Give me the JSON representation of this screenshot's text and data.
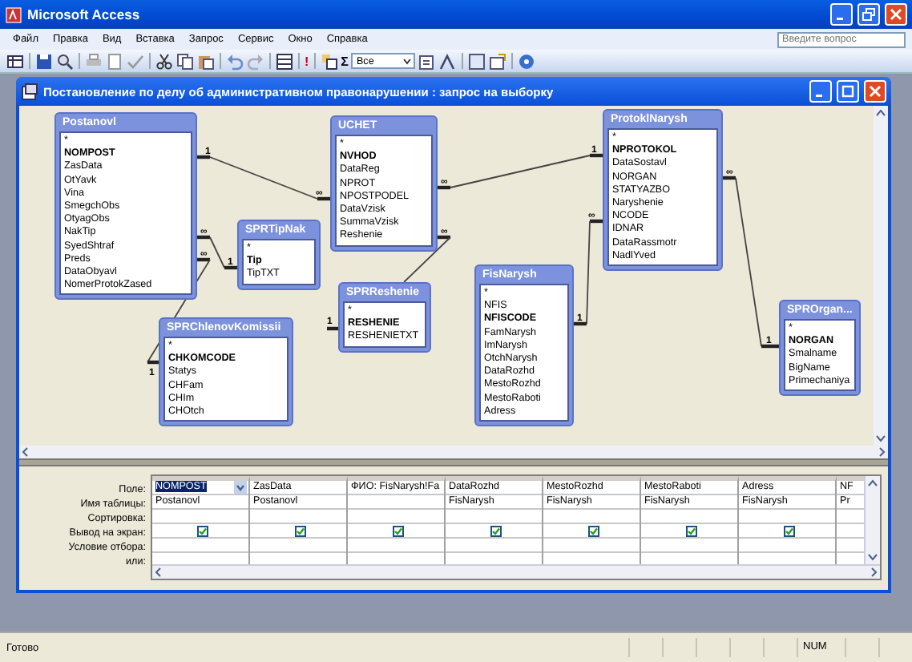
{
  "app": {
    "title": "Microsoft Access",
    "help_placeholder": "Введите вопрос"
  },
  "menu": [
    "Файл",
    "Правка",
    "Вид",
    "Вставка",
    "Запрос",
    "Сервис",
    "Окно",
    "Справка"
  ],
  "toolbar": {
    "run_symbol": "!",
    "totals_symbol": "Σ",
    "top_values": "Все"
  },
  "query_window": {
    "title": "Постановление по делу об административном правонарушении : запрос на выборку"
  },
  "tables": [
    {
      "title": "Postanovl",
      "fields": [
        {
          "name": "*",
          "key": false
        },
        {
          "name": "NOMPOST",
          "key": true
        },
        {
          "name": "ZasData",
          "key": false
        },
        {
          "name": "OtYavk",
          "key": false
        },
        {
          "name": "Vina",
          "key": false
        },
        {
          "name": "SmegchObs",
          "key": false
        },
        {
          "name": "OtyagObs",
          "key": false
        },
        {
          "name": "NakTip",
          "key": false
        },
        {
          "name": "SyedShtraf",
          "key": false
        },
        {
          "name": "Preds",
          "key": false
        },
        {
          "name": "DataObyavl",
          "key": false
        },
        {
          "name": "NomerProtokZased",
          "key": false
        }
      ]
    },
    {
      "title": "UCHET",
      "fields": [
        {
          "name": "*",
          "key": false
        },
        {
          "name": "NVHOD",
          "key": true
        },
        {
          "name": "DataReg",
          "key": false
        },
        {
          "name": "NPROT",
          "key": false
        },
        {
          "name": "NPOSTPODEL",
          "key": false
        },
        {
          "name": "DataVzisk",
          "key": false
        },
        {
          "name": "SummaVzisk",
          "key": false
        },
        {
          "name": "Reshenie",
          "key": false
        }
      ]
    },
    {
      "title": "SPRTipNak",
      "fields": [
        {
          "name": "*",
          "key": false
        },
        {
          "name": "Tip",
          "key": true
        },
        {
          "name": "TipTXT",
          "key": false
        }
      ]
    },
    {
      "title": "SPRReshenie",
      "fields": [
        {
          "name": "*",
          "key": false
        },
        {
          "name": "RESHENIE",
          "key": true
        },
        {
          "name": "RESHENIETXT",
          "key": false
        }
      ]
    },
    {
      "title": "SPRChlenovKomissii",
      "fields": [
        {
          "name": "*",
          "key": false
        },
        {
          "name": "CHKOMCODE",
          "key": true
        },
        {
          "name": "Statys",
          "key": false
        },
        {
          "name": "CHFam",
          "key": false
        },
        {
          "name": "CHIm",
          "key": false
        },
        {
          "name": "CHOtch",
          "key": false
        }
      ]
    },
    {
      "title": "ProtoklNarysh",
      "fields": [
        {
          "name": "*",
          "key": false
        },
        {
          "name": "NPROTOKOL",
          "key": true
        },
        {
          "name": "DataSostavl",
          "key": false
        },
        {
          "name": "NORGAN",
          "key": false
        },
        {
          "name": "STATYAZBO",
          "key": false
        },
        {
          "name": "Naryshenie",
          "key": false
        },
        {
          "name": "NCODE",
          "key": false
        },
        {
          "name": "IDNAR",
          "key": false
        },
        {
          "name": "DataRassmotr",
          "key": false
        },
        {
          "name": "NadlYved",
          "key": false
        }
      ]
    },
    {
      "title": "FisNarysh",
      "fields": [
        {
          "name": "*",
          "key": false
        },
        {
          "name": "NFIS",
          "key": false
        },
        {
          "name": "NFISCODE",
          "key": true
        },
        {
          "name": "FamNarysh",
          "key": false
        },
        {
          "name": "ImNarysh",
          "key": false
        },
        {
          "name": "OtchNarysh",
          "key": false
        },
        {
          "name": "DataRozhd",
          "key": false
        },
        {
          "name": "MestoRozhd",
          "key": false
        },
        {
          "name": "MestoRaboti",
          "key": false
        },
        {
          "name": "Adress",
          "key": false
        }
      ]
    },
    {
      "title": "SPROrgan...",
      "fields": [
        {
          "name": "*",
          "key": false
        },
        {
          "name": "NORGAN",
          "key": true
        },
        {
          "name": "Smalname",
          "key": false
        },
        {
          "name": "BigName",
          "key": false
        },
        {
          "name": "Primechaniya",
          "key": false
        }
      ]
    }
  ],
  "relationships": [
    {
      "from_label": "1",
      "to_label": "∞"
    },
    {
      "from_label": "∞",
      "to_label": "1"
    },
    {
      "from_label": "∞",
      "to_label": "1"
    },
    {
      "from_label": "∞",
      "to_label": "1"
    },
    {
      "from_label": "∞",
      "to_label": "1"
    },
    {
      "from_label": "∞",
      "to_label": "1"
    },
    {
      "from_label": "∞",
      "to_label": "1"
    }
  ],
  "grid": {
    "row_labels": [
      "Поле:",
      "Имя таблицы:",
      "Сортировка:",
      "Вывод на экран:",
      "Условие отбора:",
      "или:"
    ],
    "columns": [
      {
        "field": "NOMPOST",
        "table": "Postanovl",
        "show": true,
        "selected": true
      },
      {
        "field": "ZasData",
        "table": "Postanovl",
        "show": true,
        "selected": false
      },
      {
        "field": "ФИО: FisNarysh!Fa",
        "show": true,
        "selected": false
      },
      {
        "field": "DataRozhd",
        "table": "FisNarysh",
        "show": true,
        "selected": false
      },
      {
        "field": "MestoRozhd",
        "table": "FisNarysh",
        "show": true,
        "selected": false
      },
      {
        "field": "MestoRaboti",
        "table": "FisNarysh",
        "show": true,
        "selected": false
      },
      {
        "field": "Adress",
        "table": "FisNarysh",
        "show": true,
        "selected": false
      },
      {
        "field": "NF",
        "table": "Pr",
        "selected": false
      }
    ]
  },
  "status_bar": {
    "text": "Готово",
    "indicator": "NUM"
  }
}
